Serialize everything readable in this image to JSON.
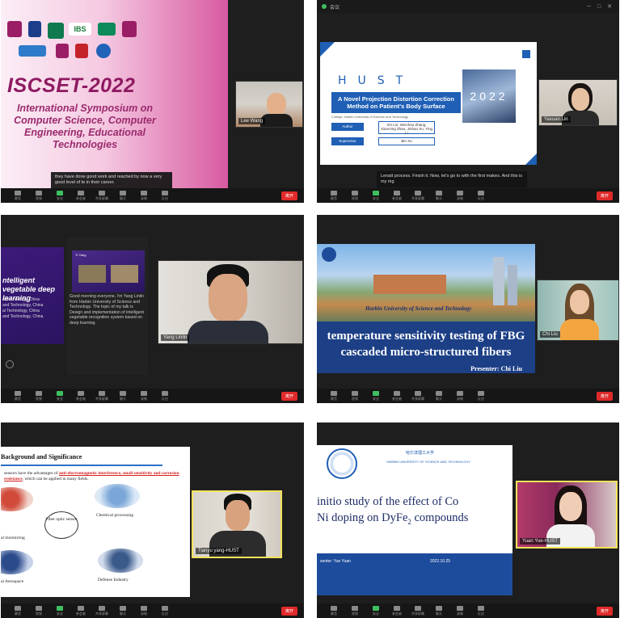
{
  "toolbar": {
    "labels": [
      "静音",
      "视频",
      "安全",
      "参会者",
      "共享屏幕",
      "聊天",
      "录制",
      "反应"
    ],
    "leave": "离开"
  },
  "panel1": {
    "title": "ISCSET-2022",
    "subtitle": "International Symposium on Computer Science, Computer Engineering, Educational Technologies",
    "logo_text": "IBS",
    "caption": "they have done good work and reached by now a very good level of te in their career.",
    "participant": "Lee Wang"
  },
  "panel2": {
    "window_title": "会议",
    "brand": "HUST",
    "title": "A Novel Projection Distortion Correction Method on Patient's Body Surface",
    "year": "2022",
    "college": "College: Harbin University of Science and Technology",
    "btn_author": "Author",
    "btn_supervisor": "Supervisor",
    "authors": "Xin Lin, Weichao Zhang, Xiaoming Zhao, Jinhao Xu, Ying Li",
    "supervisor": "Bin Xu",
    "caption": "Lenatt process. Finish it. Now, let's go to with the first makes. And this is my mg",
    "participant": "Yaxuan Lin"
  },
  "panel3": {
    "slide_title": "ntelligent vegetable deep learning",
    "slide_lines": [
      "al Technology, China",
      "and Technology, China",
      "al Technology, China",
      "and Technology, China"
    ],
    "thumb_title": "Yi Yang",
    "speech": "Good morning everyone, I'm Yang Linlin from Harbin University of Science and Technology. The topic of my talk is Design and implementation of intelligent vegetable recognition system based on deep learning.",
    "participant": "Yang Linlin"
  },
  "panel4": {
    "university": "Harbin University of Science and Technology",
    "title": "temperature sensitivity testing of FBG cascaded micro-structured fibers",
    "presenter": "Presenter: Chi Liu",
    "participant": "Chi Liu"
  },
  "panel5": {
    "heading": "Background and Significance",
    "text_before": "sensors have the advantages of ",
    "text_red": "anti-electromagnetic interference, small sensitivity and corrosion resistance",
    "text_after": ", which can be applied in many fields.",
    "center": "Fiber optic sensor",
    "apps": [
      "al monitoring",
      "Chemical processing",
      "al Aerospace",
      "Defense Industry"
    ],
    "participant": "Tianyu yang-HUST"
  },
  "panel6": {
    "university_cn": "哈尔滨理工大学",
    "university_en": "HARBIN UNIVERSITY OF SCIENCE AND TECHNOLOGY",
    "title_line1": "initio study of the effect of Co",
    "title_line2": "Ni doping on DyFe",
    "title_sub": "2",
    "title_tail": " compounds",
    "presenter": "senter: Yue Yuan",
    "date": "2022.10.25",
    "participant": "Yuan Yue-HUST"
  }
}
